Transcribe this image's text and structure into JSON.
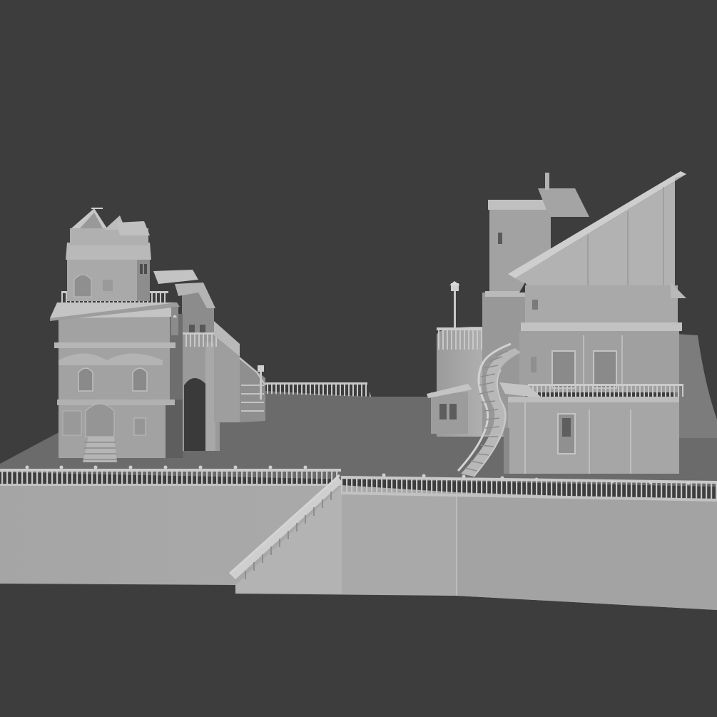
{
  "scene": {
    "kind": "untextured clay 3D model render",
    "background_color": "#3d3d3d",
    "model_color": "#a6a6a6",
    "objects": [
      "plaza-platform",
      "left-house",
      "left-annex",
      "right-mansion",
      "round-tower",
      "spiral-staircase",
      "descending-staircase",
      "perimeter-railings",
      "street-lamps"
    ]
  }
}
